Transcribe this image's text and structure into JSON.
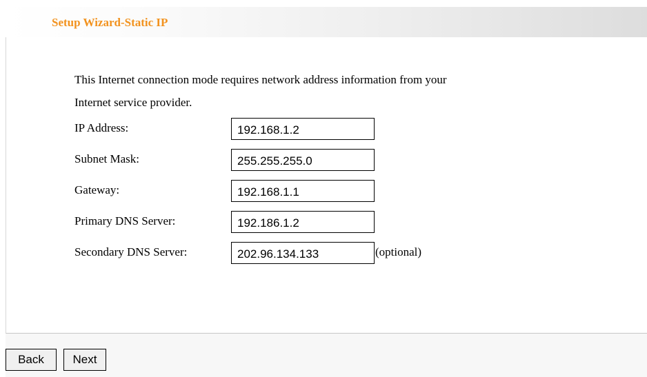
{
  "header": {
    "title": "Setup Wizard-Static IP"
  },
  "intro": {
    "line1": "This Internet connection mode requires network address information from your",
    "line2": "Internet service provider."
  },
  "fields": [
    {
      "label": "IP Address:",
      "value": "192.168.1.2"
    },
    {
      "label": "Subnet Mask:",
      "value": "255.255.255.0"
    },
    {
      "label": "Gateway:",
      "value": "192.168.1.1"
    },
    {
      "label": "Primary DNS Server:",
      "value": "192.186.1.2"
    },
    {
      "label": "Secondary DNS Server:",
      "value": "202.96.134.133",
      "note": "(optional)"
    }
  ],
  "buttons": {
    "back": "Back",
    "next": "Next"
  }
}
